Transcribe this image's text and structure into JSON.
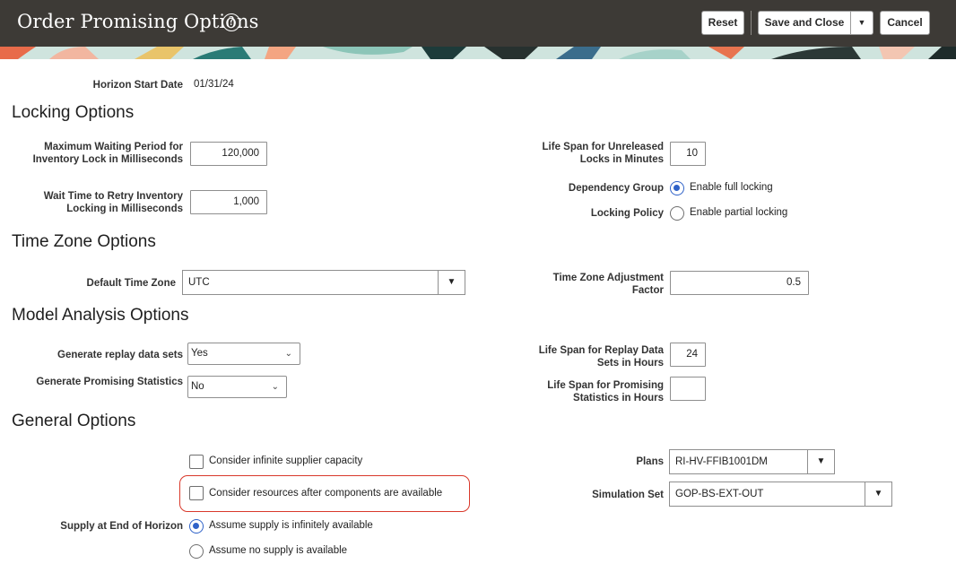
{
  "header": {
    "title": "Order Promising Options",
    "reset_label": "Reset",
    "save_close_label": "Save and Close",
    "cancel_label": "Cancel"
  },
  "horizon": {
    "label": "Horizon Start Date",
    "value": "01/31/24"
  },
  "locking": {
    "section_title": "Locking Options",
    "max_wait_label": "Maximum Waiting Period for Inventory Lock in Milliseconds",
    "max_wait_value": "120,000",
    "retry_label": "Wait Time to Retry Inventory Locking in Milliseconds",
    "retry_value": "1,000",
    "life_span_label": "Life Span for Unreleased Locks in Minutes",
    "life_span_value": "10",
    "dependency_label": "Dependency Group",
    "dependency_option": "Enable full locking",
    "policy_label": "Locking Policy",
    "policy_option": "Enable partial locking"
  },
  "timezone": {
    "section_title": "Time Zone Options",
    "default_label": "Default Time Zone",
    "default_value": "UTC",
    "adjust_label": "Time Zone Adjustment Factor",
    "adjust_value": "0.5"
  },
  "model": {
    "section_title": "Model Analysis Options",
    "replay_label": "Generate replay data sets",
    "replay_value": "Yes",
    "stats_label": "Generate Promising Statistics",
    "stats_value": "No",
    "replay_life_label": "Life Span for Replay Data Sets in Hours",
    "replay_life_value": "24",
    "stats_life_label": "Life Span for Promising Statistics in Hours",
    "stats_life_value": ""
  },
  "general": {
    "section_title": "General Options",
    "infinite_supplier_label": "Consider infinite supplier capacity",
    "resources_label": "Consider resources after components are available",
    "supply_label": "Supply at End of Horizon",
    "supply_option_1": "Assume supply is infinitely available",
    "supply_option_2": "Assume no supply is available",
    "plans_label": "Plans",
    "plans_value": "RI-HV-FFIB1001DM",
    "simulation_label": "Simulation Set",
    "simulation_value": "GOP-BS-EXT-OUT"
  },
  "icons": {
    "help": "help-circle-icon",
    "dropdown": "caret-down-icon",
    "chevron": "chevron-down-icon"
  },
  "colors": {
    "header_bg": "#3d3a36",
    "radio_selected": "#2f62c8",
    "highlight_box": "#d9392b"
  }
}
